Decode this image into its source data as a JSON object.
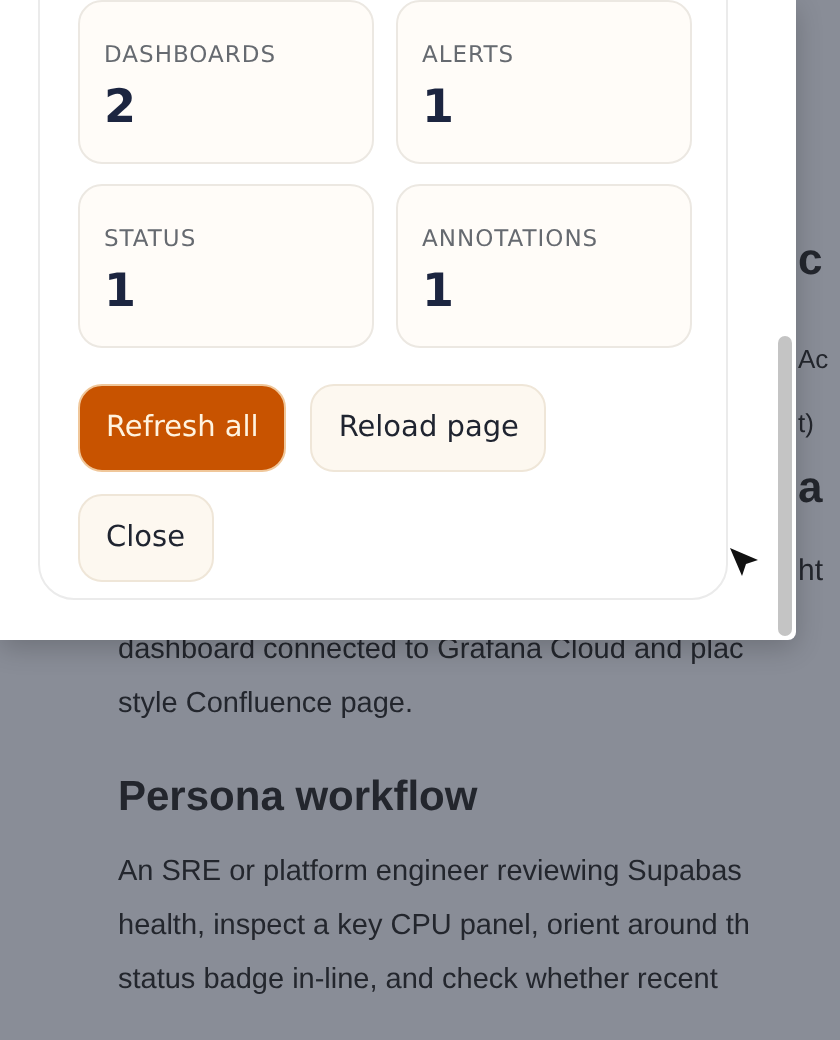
{
  "dialog": {
    "stats": [
      {
        "label": "DASHBOARDS",
        "value": "2"
      },
      {
        "label": "ALERTS",
        "value": "1"
      },
      {
        "label": "STATUS",
        "value": "1"
      },
      {
        "label": "ANNOTATIONS",
        "value": "1"
      }
    ],
    "buttons": [
      {
        "label": "Refresh all",
        "kind": "primary"
      },
      {
        "label": "Reload page",
        "kind": "secondary"
      },
      {
        "label": "Close",
        "kind": "secondary"
      }
    ]
  },
  "background_page": {
    "edge_fragments": [
      {
        "text": "c",
        "kind": "heading"
      },
      {
        "text": "Ac",
        "kind": "text"
      },
      {
        "text": "t)",
        "kind": "text"
      },
      {
        "text": "a",
        "kind": "heading"
      },
      {
        "text": "ht",
        "kind": "text"
      }
    ],
    "covered_line": "dashboard connected to Grafana Cloud and plac",
    "intro_end": "style Confluence page.",
    "heading": "Persona workflow",
    "paragraph_lines": [
      "An SRE or platform engineer reviewing Supabas",
      "health, inspect a key CPU panel, orient around th",
      "status badge in-line, and check whether recent"
    ]
  }
}
